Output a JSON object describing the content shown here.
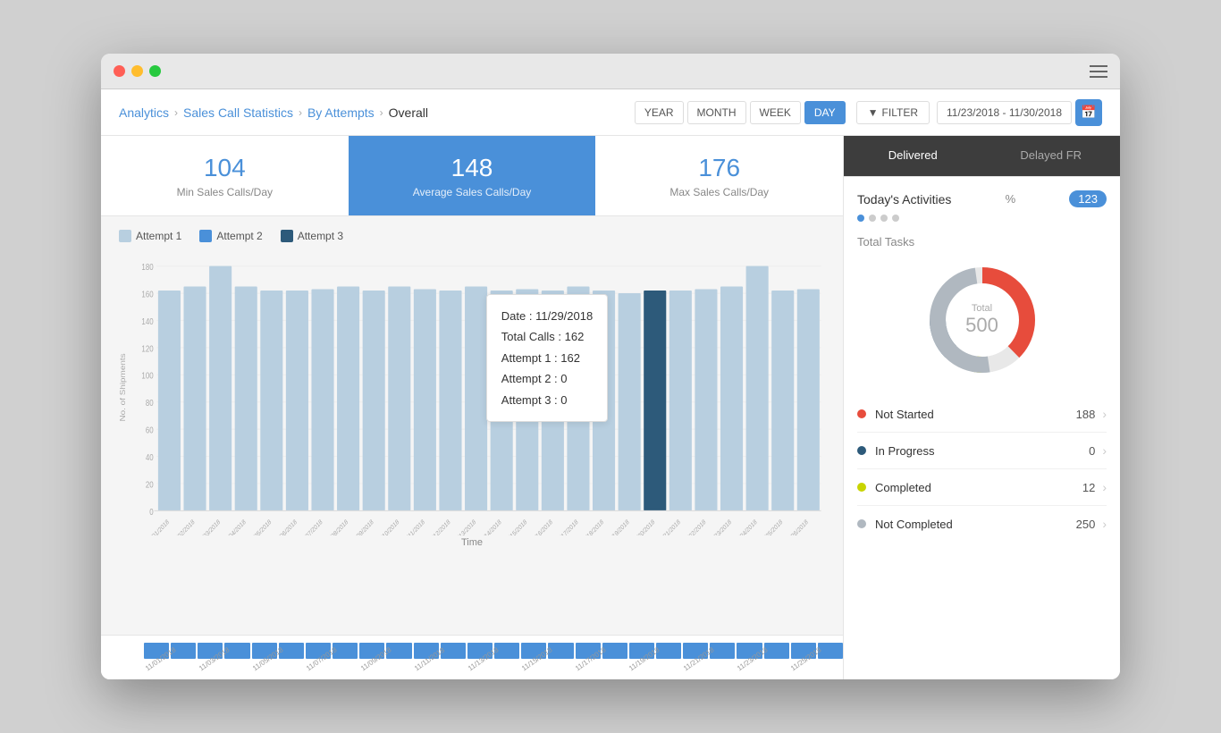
{
  "window": {
    "title": "Sales Call Statistics"
  },
  "breadcrumb": {
    "items": [
      "Analytics",
      "Sales Call Statistics",
      "By Attempts",
      "Overall"
    ],
    "separators": [
      ">",
      ">",
      ">"
    ]
  },
  "header": {
    "period_buttons": [
      "YEAR",
      "MONTH",
      "WEEK",
      "DAY"
    ],
    "active_period": "DAY",
    "filter_label": "FILTER",
    "date_range": "11/23/2018 - 11/30/2018",
    "calendar_icon": "📅"
  },
  "stats": {
    "min_value": "104",
    "min_label": "Min Sales Calls/Day",
    "avg_value": "148",
    "avg_label": "Average Sales Calls/Day",
    "max_value": "176",
    "max_label": "Max Sales Calls/Day"
  },
  "legend": {
    "items": [
      {
        "label": "Attempt 1",
        "color": "#b8cfe0"
      },
      {
        "label": "Attempt 2",
        "color": "#4a90d9"
      },
      {
        "label": "Attempt 3",
        "color": "#2d5a7a"
      }
    ]
  },
  "chart": {
    "y_label": "No. of Shipments",
    "x_label": "Time",
    "y_ticks": [
      0,
      20,
      40,
      60,
      80,
      100,
      120,
      140,
      160,
      180
    ],
    "dates": [
      "11/01/2018",
      "11/02/2018",
      "11/03/2018",
      "11/04/2018",
      "11/05/2018",
      "11/06/2018",
      "11/07/2018",
      "11/08/2018",
      "11/09/2018",
      "11/10/2018",
      "11/11/2018",
      "11/12/2018",
      "11/13/2018",
      "11/14/2018",
      "11/15/2018",
      "11/16/2018",
      "11/17/2018",
      "11/18/2018",
      "11/19/2018",
      "11/20/2018",
      "11/21/2018",
      "11/22/2018",
      "11/23/2018",
      "11/24/2018",
      "11/25/2018",
      "11/26/2018"
    ],
    "bars": [
      162,
      165,
      180,
      165,
      162,
      162,
      163,
      165,
      162,
      165,
      163,
      162,
      165,
      162,
      163,
      162,
      165,
      162,
      160,
      162,
      162,
      163,
      165,
      180,
      162,
      163
    ]
  },
  "tooltip": {
    "date_label": "Date :",
    "date_value": "11/29/2018",
    "total_label": "Total Calls :",
    "total_value": "162",
    "attempt1_label": "Attempt 1 :",
    "attempt1_value": "162",
    "attempt2_label": "Attempt 2 :",
    "attempt2_value": "0",
    "attempt3_label": "Attempt 3 :",
    "attempt3_value": "0"
  },
  "right_panel": {
    "tabs": [
      "Delivered",
      "Delayed FR"
    ],
    "active_tab": "Delivered",
    "today_activities": {
      "title": "Today's Activities",
      "percent_label": "%",
      "badge": "123",
      "dots_count": 4,
      "active_dot": 0
    },
    "total_tasks_label": "Total Tasks",
    "donut": {
      "total_label": "Total",
      "total_value": "500",
      "segments": [
        {
          "color": "#e74c3c",
          "value": 188,
          "pct": 37.6
        },
        {
          "color": "#2d5a7a",
          "value": 62,
          "pct": 12.4
        },
        {
          "color": "#c8d400",
          "value": 12,
          "pct": 2.4
        },
        {
          "color": "#b0b8c0",
          "value": 250,
          "pct": 50
        }
      ]
    },
    "task_items": [
      {
        "label": "Not Started",
        "count": "188",
        "color": "#e74c3c"
      },
      {
        "label": "In Progress",
        "count": "0",
        "color": "#2d5a7a"
      },
      {
        "label": "Completed",
        "count": "12",
        "color": "#c8d400"
      },
      {
        "label": "Not Completed",
        "count": "250",
        "color": "#b0b8c0"
      }
    ]
  },
  "timeline": {
    "dates": [
      "11/01/2018",
      "11/03/2018",
      "11/05/2018",
      "11/07/2018",
      "11/09/2018",
      "11/11/2018",
      "11/13/2018",
      "11/15/2018",
      "11/17/2018",
      "11/19/2018",
      "11/21/2018",
      "11/23/2018",
      "11/25/2018"
    ]
  }
}
